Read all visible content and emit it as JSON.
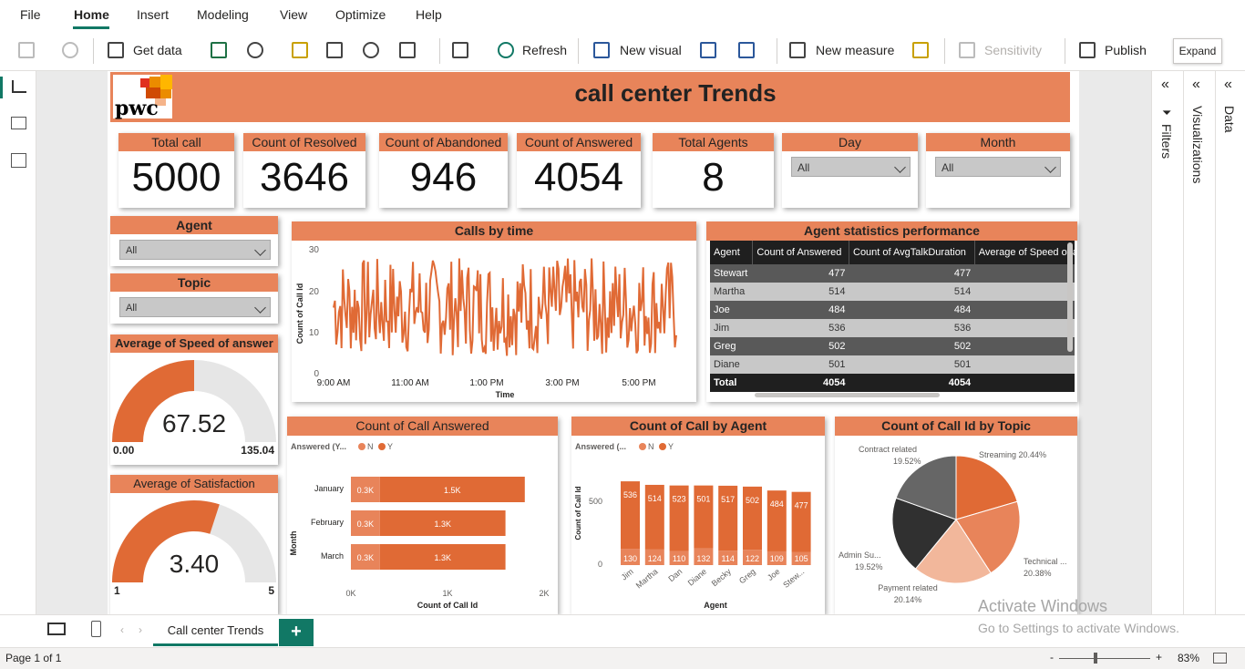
{
  "menu": {
    "items": [
      "File",
      "Home",
      "Insert",
      "Modeling",
      "View",
      "Optimize",
      "Help"
    ]
  },
  "ribbon": {
    "get_data": "Get data",
    "refresh": "Refresh",
    "new_visual": "New visual",
    "new_measure": "New measure",
    "sensitivity": "Sensitivity",
    "publish": "Publish",
    "expand_tooltip": "Expand"
  },
  "panes": {
    "filters": "Filters",
    "visualizations": "Visualizations",
    "data": "Data"
  },
  "report": {
    "title": "call center Trends",
    "logo_text": "pwc"
  },
  "kpis": [
    {
      "label": "Total call",
      "value": "5000"
    },
    {
      "label": "Count of Resolved",
      "value": "3646"
    },
    {
      "label": "Count of Abandoned",
      "value": "946"
    },
    {
      "label": "Count of Answered",
      "value": "4054"
    },
    {
      "label": "Total Agents",
      "value": "8"
    }
  ],
  "slicers": {
    "day": {
      "label": "Day",
      "value": "All"
    },
    "month": {
      "label": "Month",
      "value": "All"
    },
    "agent": {
      "label": "Agent",
      "value": "All"
    },
    "topic": {
      "label": "Topic",
      "value": "All"
    }
  },
  "gauges": {
    "speed": {
      "title": "Average of Speed of answer",
      "value": "67.52",
      "min": "0.00",
      "max": "135.04",
      "fraction": 0.5
    },
    "satisfaction": {
      "title": "Average of Satisfaction",
      "value": "3.40",
      "min": "1",
      "max": "5",
      "fraction": 0.6
    }
  },
  "calls_by_time": {
    "title": "Calls by time",
    "ylabel": "Count of Call Id",
    "xlabel": "Time",
    "yticks": [
      "30",
      "20",
      "10",
      "0"
    ],
    "xticks": [
      "9:00 AM",
      "11:00 AM",
      "1:00 PM",
      "3:00 PM",
      "5:00 PM"
    ]
  },
  "agent_table": {
    "title": "Agent statistics performance",
    "columns": [
      "Agent",
      "Count of Answered",
      "Count of AvgTalkDuration",
      "Average of Speed of a"
    ],
    "rows": [
      [
        "Stewart",
        "477",
        "477"
      ],
      [
        "Martha",
        "514",
        "514"
      ],
      [
        "Joe",
        "484",
        "484"
      ],
      [
        "Jim",
        "536",
        "536"
      ],
      [
        "Greg",
        "502",
        "502"
      ],
      [
        "Diane",
        "501",
        "501"
      ]
    ],
    "total": [
      "Total",
      "4054",
      "4054"
    ]
  },
  "answered_chart": {
    "title": "Count of Call Answered",
    "legend_title": "Answered (Y...",
    "legend": [
      "N",
      "Y"
    ],
    "ylabel": "Month",
    "xlabel": "Count of Call Id",
    "xticks": [
      "0K",
      "1K",
      "2K"
    ],
    "rows": [
      {
        "month": "January",
        "n_label": "0.3K",
        "y_label": "1.5K"
      },
      {
        "month": "February",
        "n_label": "0.3K",
        "y_label": "1.3K"
      },
      {
        "month": "March",
        "n_label": "0.3K",
        "y_label": "1.3K"
      }
    ]
  },
  "agent_chart": {
    "title": "Count of Call by Agent",
    "legend_title": "Answered (...",
    "legend": [
      "N",
      "Y"
    ],
    "ylabel": "Count of Call Id",
    "xlabel": "Agent",
    "yticks": [
      "500",
      "0"
    ],
    "agents": [
      "Jim",
      "Martha",
      "Dan",
      "Diane",
      "Becky",
      "Greg",
      "Joe",
      "Stew..."
    ]
  },
  "topic_chart": {
    "title": "Count of Call Id by Topic",
    "labels": [
      "Streaming 20.44%",
      "Technical ...",
      "20.38%",
      "Payment related",
      "20.14%",
      "Admin Su...",
      "19.52%",
      "Contract related",
      "19.52%"
    ]
  },
  "chart_data": [
    {
      "type": "bar",
      "title": "Count of Call Answered",
      "categories": [
        "January",
        "February",
        "March"
      ],
      "series": [
        {
          "name": "N",
          "values": [
            300,
            300,
            300
          ]
        },
        {
          "name": "Y",
          "values": [
            1500,
            1300,
            1300
          ]
        }
      ],
      "xlabel": "Count of Call Id",
      "ylabel": "Month"
    },
    {
      "type": "bar",
      "title": "Count of Call by Agent",
      "categories": [
        "Jim",
        "Martha",
        "Dan",
        "Diane",
        "Becky",
        "Greg",
        "Joe",
        "Stew..."
      ],
      "series": [
        {
          "name": "N",
          "values": [
            130,
            124,
            110,
            132,
            114,
            122,
            109,
            105
          ]
        },
        {
          "name": "Y",
          "values": [
            536,
            514,
            523,
            501,
            517,
            502,
            484,
            477
          ]
        }
      ],
      "xlabel": "Agent",
      "ylabel": "Count of Call Id"
    },
    {
      "type": "pie",
      "title": "Count of Call Id by Topic",
      "categories": [
        "Streaming",
        "Technical ...",
        "Payment related",
        "Admin Su...",
        "Contract related"
      ],
      "values": [
        20.44,
        20.38,
        20.14,
        19.52,
        19.52
      ]
    }
  ],
  "bottom": {
    "tab": "Call center Trends",
    "add": "+",
    "page": "Page 1 of 1",
    "zoom": "83%"
  },
  "watermark": {
    "line1": "Activate Windows",
    "line2": "Go to Settings to activate Windows."
  },
  "colors": {
    "accent": "#e8845a",
    "brand": "#117865",
    "dark_orange": "#e06a35"
  }
}
